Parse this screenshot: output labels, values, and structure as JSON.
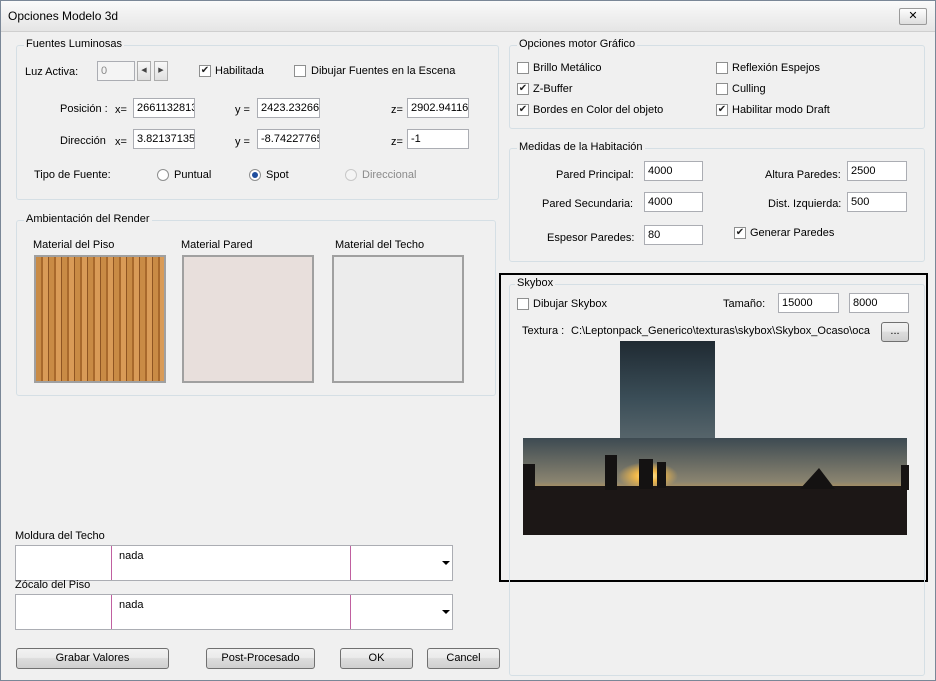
{
  "window": {
    "title": "Opciones Modelo 3d",
    "close_label": "✕"
  },
  "fuentes": {
    "group_label": "Fuentes Luminosas",
    "luz_activa_label": "Luz Activa:",
    "luz_activa_value": "0",
    "habilitada_label": "Habilitada",
    "habilitada_checked": true,
    "dibujar_fuentes_label": "Dibujar Fuentes en la Escena",
    "dibujar_fuentes_checked": false,
    "posicion_label": "Posición :",
    "direccion_label": "Dirección",
    "x_label": "x=",
    "y_label": "y =",
    "z_label": "z=",
    "pos_x": "2661132813",
    "pos_y": "2423.23266",
    "pos_z": "2902.94116",
    "dir_x": "3.82137135",
    "dir_y": "-8.74227765",
    "dir_z": "-1",
    "tipo_label": "Tipo de Fuente:",
    "tipo_puntual": "Puntual",
    "tipo_spot": "Spot",
    "tipo_direccional": "Direccional",
    "tipo_selected": "Spot"
  },
  "ambientacion": {
    "group_label": "Ambientación del Render",
    "piso_label": "Material del Piso",
    "pared_label": "Material Pared",
    "techo_label": "Material del Techo"
  },
  "moldura": {
    "label": "Moldura del Techo",
    "value": "nada"
  },
  "zocalo": {
    "label": "Zócalo del Piso",
    "value": "nada"
  },
  "buttons": {
    "grabar": "Grabar Valores",
    "post": "Post-Procesado",
    "ok": "OK",
    "cancel": "Cancel"
  },
  "motor": {
    "group_label": "Opciones motor Gráfico",
    "brillo": "Brillo Metálico",
    "zbuffer": "Z-Buffer",
    "bordes": "Bordes en Color del objeto",
    "reflexion": "Reflexión Espejos",
    "culling": "Culling",
    "draft": "Habilitar modo Draft",
    "brillo_checked": false,
    "zbuffer_checked": true,
    "bordes_checked": true,
    "reflexion_checked": false,
    "culling_checked": false,
    "draft_checked": true
  },
  "medidas": {
    "group_label": "Medidas de la Habitación",
    "pared_principal_label": "Pared Principal:",
    "pared_principal": "4000",
    "pared_secundaria_label": "Pared Secundaria:",
    "pared_secundaria": "4000",
    "espesor_label": "Espesor Paredes:",
    "espesor": "80",
    "altura_label": "Altura Paredes:",
    "altura": "2500",
    "dist_label": "Dist. Izquierda:",
    "dist": "500",
    "generar_label": "Generar Paredes",
    "generar_checked": true
  },
  "skybox": {
    "group_label": "Skybox",
    "dibujar_label": "Dibujar Skybox",
    "dibujar_checked": false,
    "tamano_label": "Tamaño:",
    "tamano_1": "15000",
    "tamano_2": "8000",
    "textura_label": "Textura :",
    "textura_path": "C:\\Leptonpack_Generico\\texturas\\skybox\\Skybox_Ocaso\\oca",
    "browse_label": "..."
  },
  "colors": {
    "accent": "#1f4e9e",
    "window_bg": "#f0f0f0",
    "highlight_frame": "#000000"
  }
}
